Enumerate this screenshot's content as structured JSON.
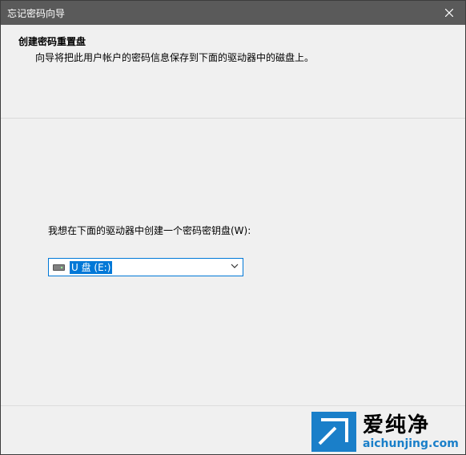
{
  "window": {
    "title": "忘记密码向导"
  },
  "header": {
    "title": "创建密码重置盘",
    "subtitle": "向导将把此用户帐户的密码信息保存到下面的驱动器中的磁盘上。"
  },
  "main": {
    "drive_label": "我想在下面的驱动器中创建一个密码密钥盘(W):",
    "drive_select": {
      "value": "U 盘 (E:)",
      "icon": "usb-drive-icon"
    }
  },
  "watermark": {
    "brand": "爱纯净",
    "url": "aichunjing.com"
  },
  "colors": {
    "titlebar": "#5a5a5a",
    "accent": "#0078d7",
    "background": "#f0f0f0"
  }
}
